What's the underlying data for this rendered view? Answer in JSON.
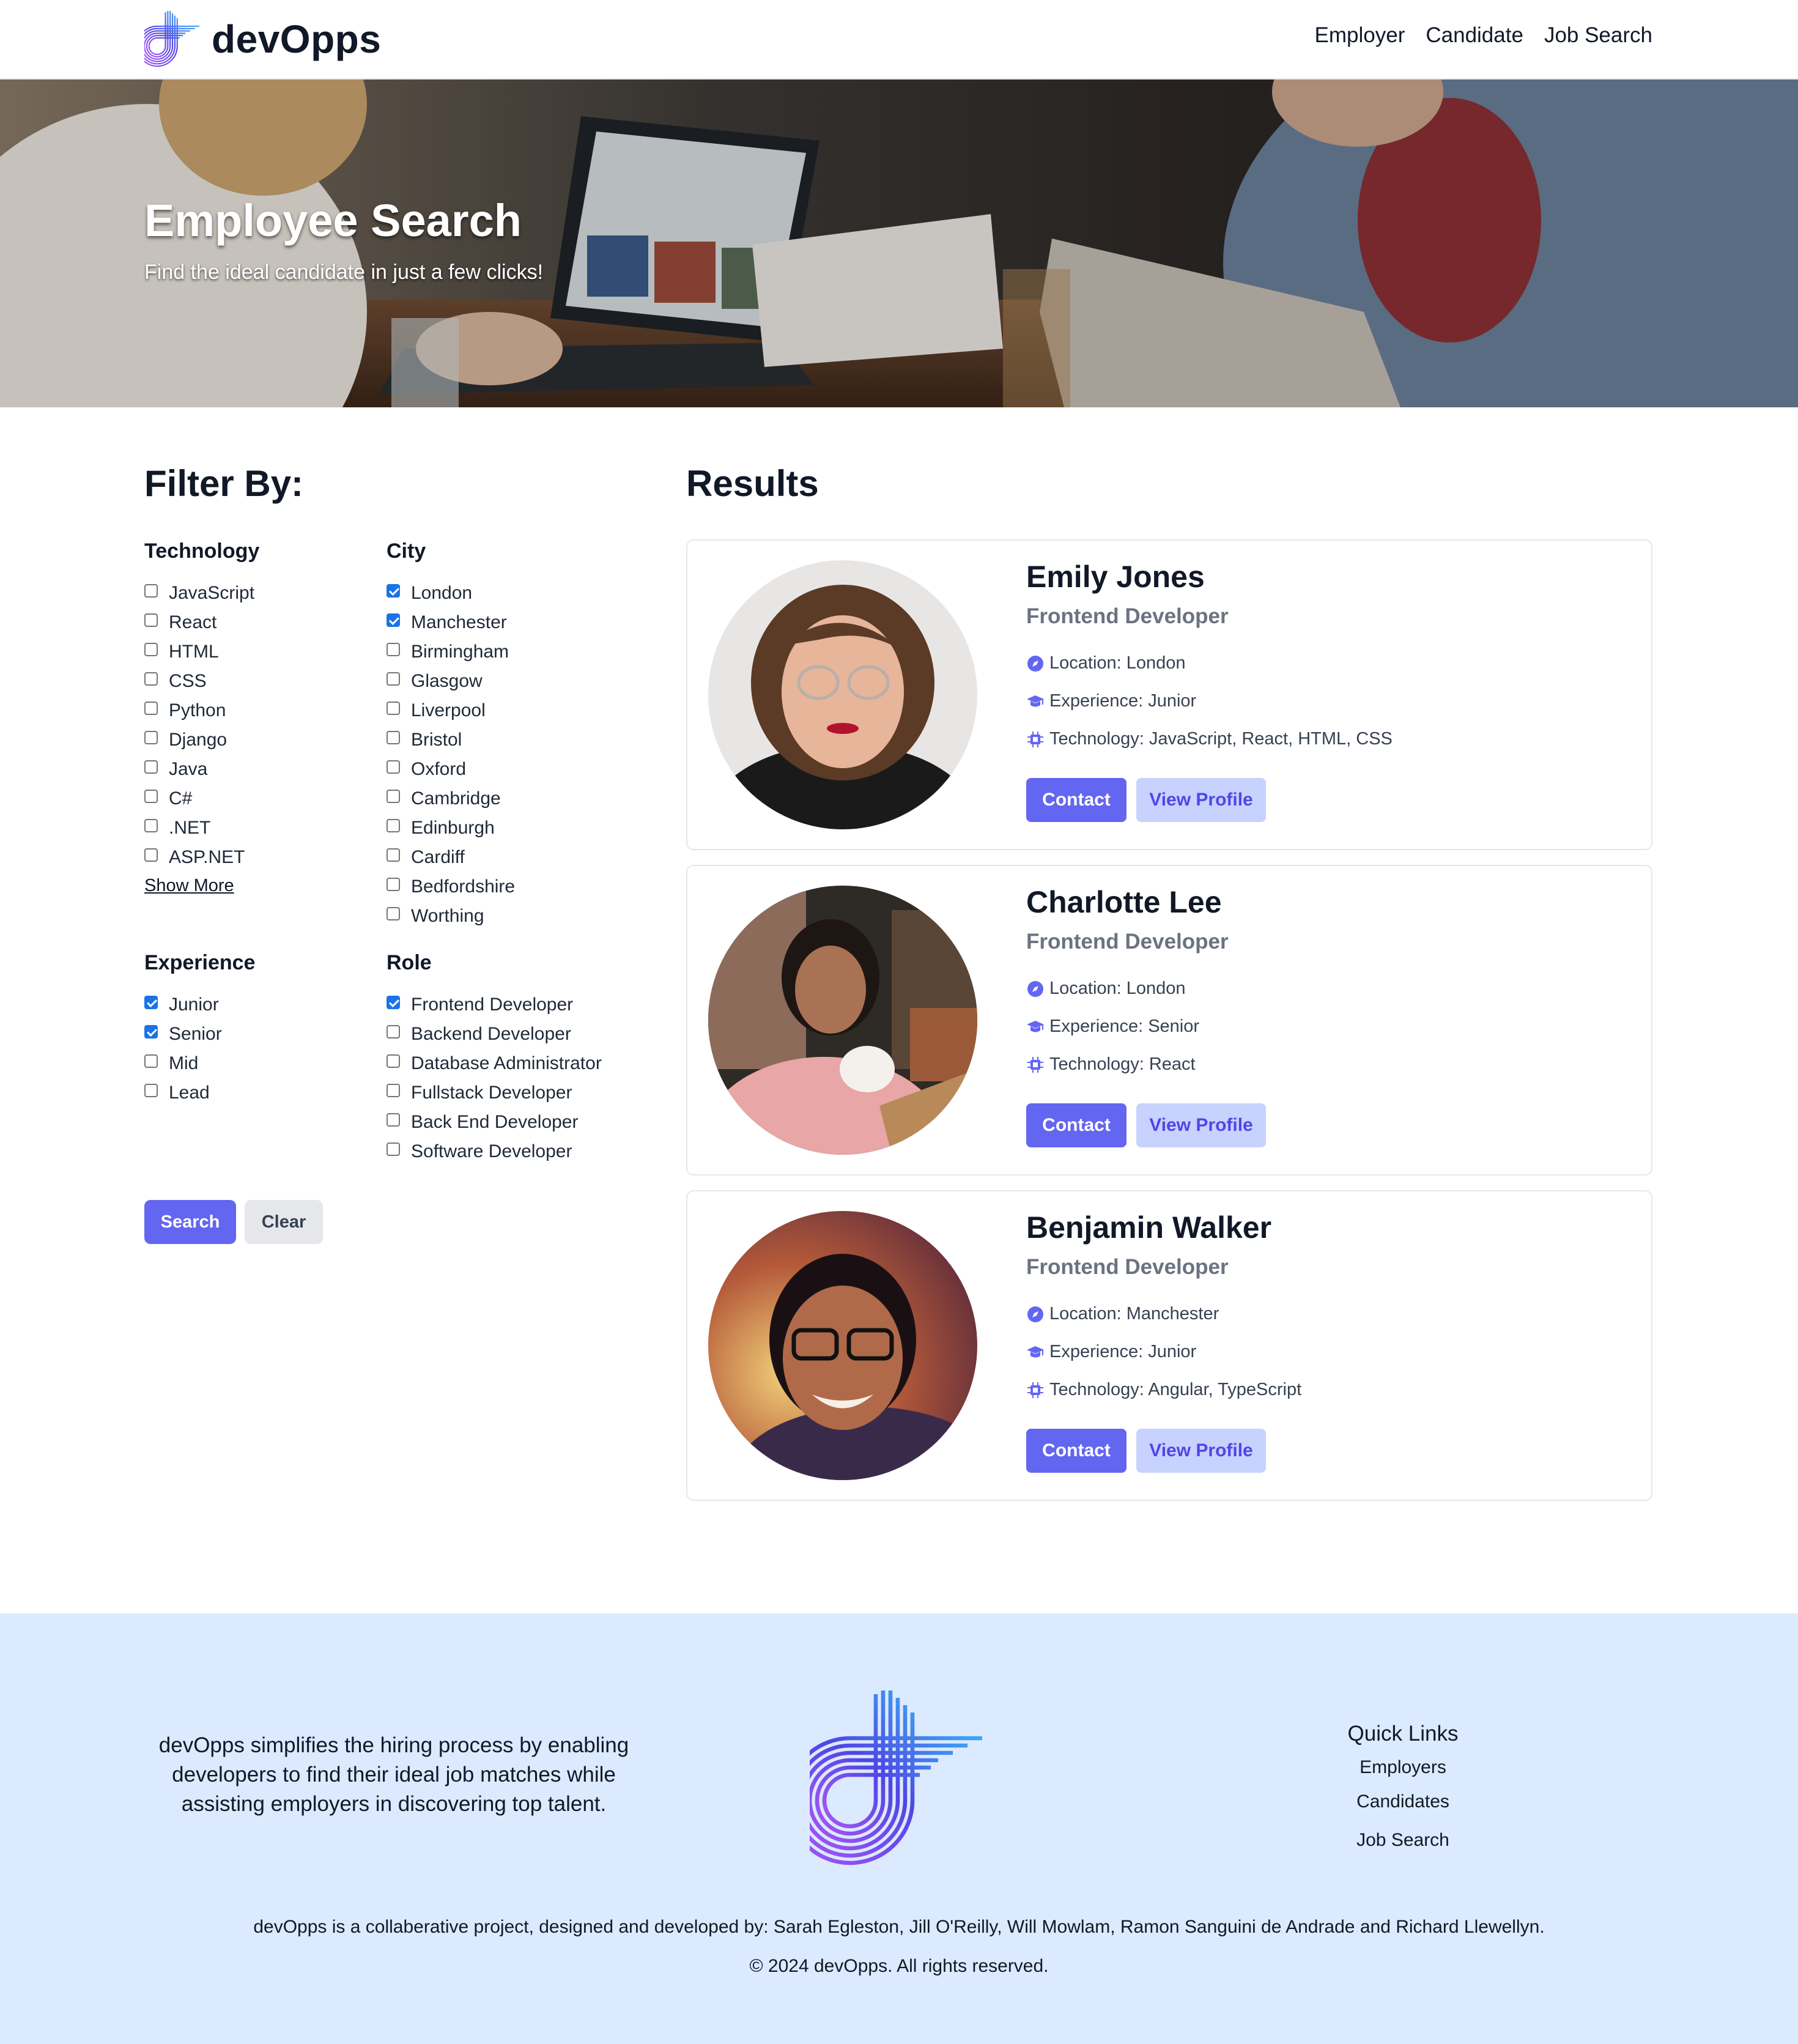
{
  "header": {
    "brand": "devOpps",
    "nav": [
      "Employer",
      "Candidate",
      "Job Search"
    ]
  },
  "hero": {
    "title": "Employee Search",
    "subtitle": "Find the ideal candidate in just a few clicks!"
  },
  "filters": {
    "title": "Filter By:",
    "technology": {
      "label": "Technology",
      "options": [
        "JavaScript",
        "React",
        "HTML",
        "CSS",
        "Python",
        "Django",
        "Java",
        "C#",
        ".NET",
        "ASP.NET"
      ],
      "checked": [
        false,
        false,
        false,
        false,
        false,
        false,
        false,
        false,
        false,
        false
      ],
      "show_more": "Show More"
    },
    "city": {
      "label": "City",
      "options": [
        "London",
        "Manchester",
        "Birmingham",
        "Glasgow",
        "Liverpool",
        "Bristol",
        "Oxford",
        "Cambridge",
        "Edinburgh",
        "Cardiff",
        "Bedfordshire",
        "Worthing"
      ],
      "checked": [
        true,
        true,
        false,
        false,
        false,
        false,
        false,
        false,
        false,
        false,
        false,
        false
      ]
    },
    "experience": {
      "label": "Experience",
      "options": [
        "Junior",
        "Senior",
        "Mid",
        "Lead"
      ],
      "checked": [
        true,
        true,
        false,
        false
      ]
    },
    "role": {
      "label": "Role",
      "options": [
        "Frontend Developer",
        "Backend Developer",
        "Database Administrator",
        "Fullstack Developer",
        "Back End Developer",
        "Software Developer"
      ],
      "checked": [
        true,
        false,
        false,
        false,
        false,
        false
      ]
    },
    "search_label": "Search",
    "clear_label": "Clear"
  },
  "results": {
    "title": "Results",
    "cards": [
      {
        "name": "Emily Jones",
        "role": "Frontend Developer",
        "location": "Location: London",
        "experience": "Experience: Junior",
        "technology": "Technology: JavaScript, React, HTML, CSS",
        "contact_label": "Contact",
        "view_label": "View Profile"
      },
      {
        "name": "Charlotte Lee",
        "role": "Frontend Developer",
        "location": "Location: London",
        "experience": "Experience: Senior",
        "technology": "Technology: React",
        "contact_label": "Contact",
        "view_label": "View Profile"
      },
      {
        "name": "Benjamin Walker",
        "role": "Frontend Developer",
        "location": "Location: Manchester",
        "experience": "Experience: Junior",
        "technology": "Technology: Angular, TypeScript",
        "contact_label": "Contact",
        "view_label": "View Profile"
      }
    ]
  },
  "footer": {
    "about": "devOpps simplifies the hiring process by enabling developers to find their ideal job matches while assisting employers in discovering top talent.",
    "quick_links_title": "Quick Links",
    "quick_links": [
      "Employers",
      "Candidates",
      "Job Search"
    ],
    "credits": "devOpps is a collaberative project, designed and developed by: Sarah Egleston, Jill O'Reilly, Will Mowlam, Ramon Sanguini de Andrade and Richard Llewellyn.",
    "copyright": "© 2024 devOpps. All rights reserved."
  },
  "colors": {
    "accent": "#6366f1",
    "accent_light": "#c7d2fe",
    "footer_bg": "#dbeafe",
    "checkbox": "#1a73e8"
  },
  "icons": {
    "location": "compass-icon",
    "experience": "graduation-cap-icon",
    "technology": "microchip-icon"
  }
}
